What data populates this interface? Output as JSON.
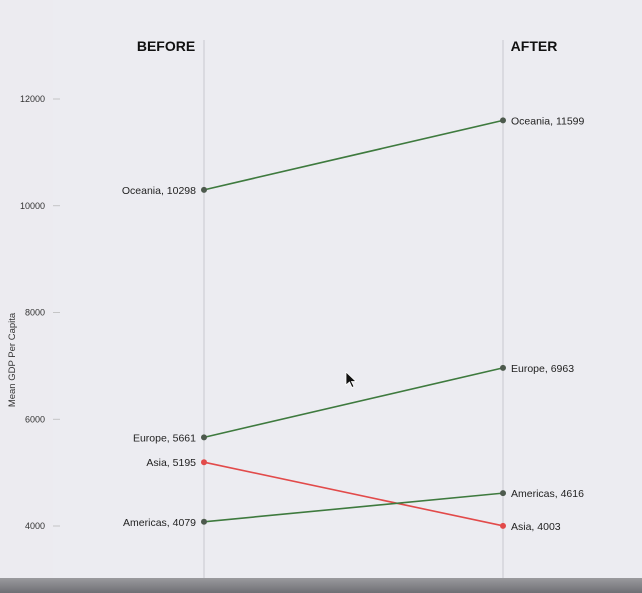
{
  "chart_data": {
    "type": "slope",
    "columns": [
      "BEFORE",
      "AFTER"
    ],
    "ylabel": "Mean GDP Per Capita",
    "ylim": [
      3000,
      13000
    ],
    "yticks": [
      4000,
      6000,
      8000,
      10000,
      12000
    ],
    "series": [
      {
        "name": "Oceania",
        "values": [
          10298,
          11599
        ],
        "color": "#3e7a3e"
      },
      {
        "name": "Europe",
        "values": [
          5661,
          6963
        ],
        "color": "#3e7a3e"
      },
      {
        "name": "Asia",
        "values": [
          5195,
          4003
        ],
        "color": "#e24a4a"
      },
      {
        "name": "Americas",
        "values": [
          4079,
          4616
        ],
        "color": "#3e7a3e"
      }
    ],
    "labels_before": [
      "Oceania, 10298",
      "Europe, 5661",
      "Asia, 5195",
      "Americas, 4079"
    ],
    "labels_after": [
      "Oceania, 11599",
      "Europe, 6963",
      "Asia, 4003",
      "Americas, 4616"
    ],
    "grid": false
  },
  "colors": {
    "background": "#ececf1",
    "increase": "#3e7a3e",
    "decrease": "#e24a4a",
    "marker": "#4d5a4d"
  },
  "cursor_icon": "pointer-arrow-icon"
}
